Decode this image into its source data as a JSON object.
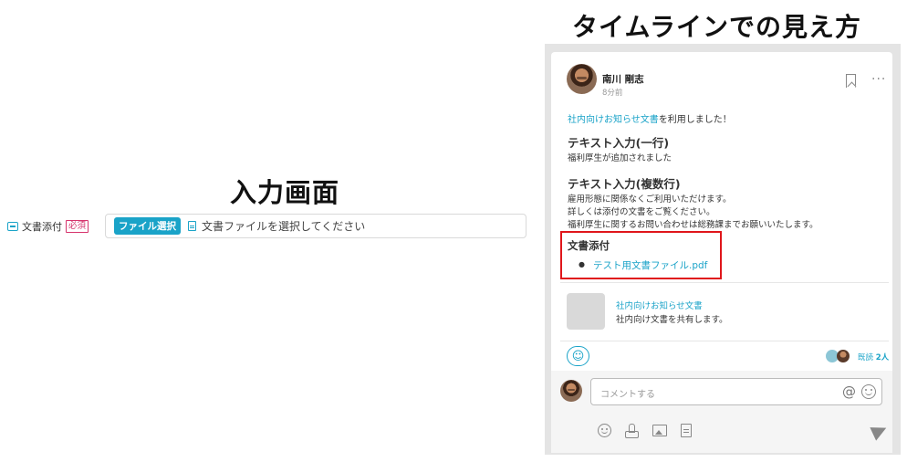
{
  "input_screen": {
    "title": "入力画面",
    "field": {
      "label": "文書添付",
      "required_badge": "必須",
      "file_button_label": "ファイル選択",
      "placeholder": "文書ファイルを選択してください"
    }
  },
  "timeline_screen": {
    "title": "タイムラインでの見え方",
    "post": {
      "author": "南川 剛志",
      "time": "8分前",
      "intro_link": "社内向けお知らせ文書",
      "intro_suffix": "を利用しました！",
      "sections": [
        {
          "title": "テキスト入力(一行)",
          "text": "福利厚生が追加されました"
        },
        {
          "title": "テキスト入力(複数行)",
          "lines": [
            "雇用形態に関係なくご利用いただけます。",
            "詳しくは添付の文書をご覧ください。",
            "福利厚生に関するお問い合わせは総務課までお願いいたします。"
          ]
        }
      ],
      "attachment": {
        "title": "文書添付",
        "file_name": "テスト用文書ファイル.pdf"
      },
      "link_card": {
        "title": "社内向けお知らせ文書",
        "description": "社内向け文書を共有します。"
      },
      "read_label": "既読",
      "read_count": "2人"
    },
    "comment": {
      "placeholder": "コメントする",
      "at_symbol": "@"
    }
  },
  "colors": {
    "accent": "#1aa3c8",
    "highlight": "#e0161b",
    "required": "#d6336c"
  }
}
